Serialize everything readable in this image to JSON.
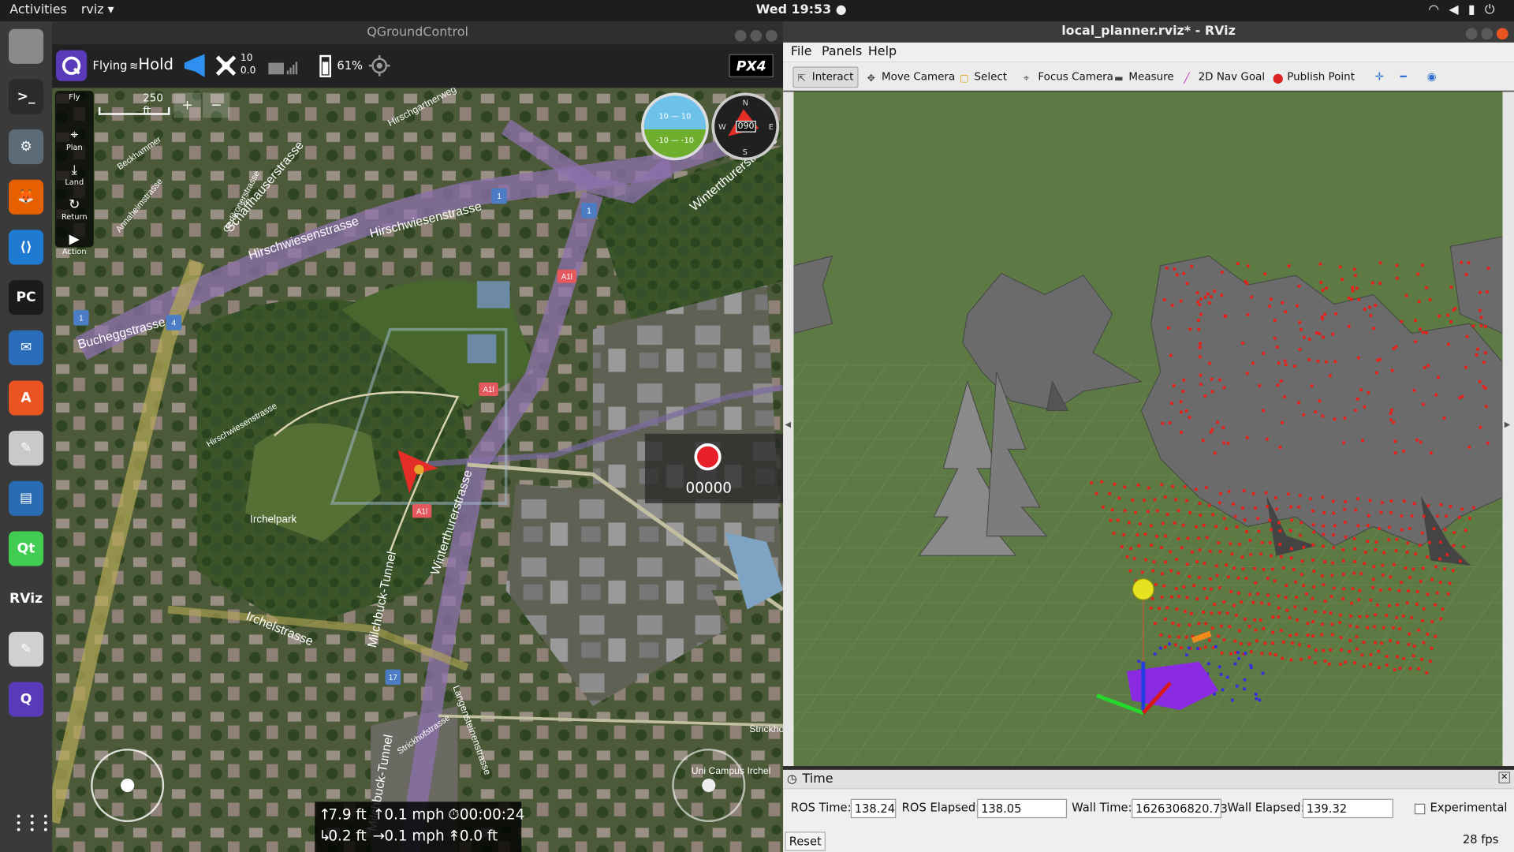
{
  "topbar": {
    "activities": "Activities",
    "app_name": "rviz ▾",
    "clock": "Wed 19:53 ●",
    "tray_icons": [
      "wifi-icon",
      "volume-icon",
      "battery-icon",
      "power-icon"
    ]
  },
  "dock": {
    "apps": [
      {
        "name": "files",
        "label": "",
        "color": "#8a8a8a"
      },
      {
        "name": "terminal",
        "label": ">_",
        "color": "#2b2b2b"
      },
      {
        "name": "settings",
        "label": "⚙",
        "color": "#5c6b78"
      },
      {
        "name": "firefox",
        "label": "🦊",
        "color": "#e66000"
      },
      {
        "name": "vscode",
        "label": "⟨⟩",
        "color": "#1f7ad2"
      },
      {
        "name": "pycharm",
        "label": "PC",
        "color": "#1b1b1b"
      },
      {
        "name": "thunderbird",
        "label": "✉",
        "color": "#2a6ebb"
      },
      {
        "name": "software",
        "label": "A",
        "color": "#e95420"
      },
      {
        "name": "text-editor",
        "label": "✎",
        "color": "#c9c9c9"
      },
      {
        "name": "libreoffice-writer",
        "label": "▤",
        "color": "#2a6cb2"
      },
      {
        "name": "qt-creator",
        "label": "Qt",
        "color": "#41cd52"
      },
      {
        "name": "rviz",
        "label": "RViz",
        "color": "#3a3a3a"
      },
      {
        "name": "gedit",
        "label": "✎",
        "color": "#d0d0d0"
      },
      {
        "name": "qgroundcontrol",
        "label": "Q",
        "color": "#5a3ab8"
      }
    ]
  },
  "qgc": {
    "window_title": "QGroundControl",
    "flight_mode_state": "Flying",
    "flight_mode": "Hold",
    "gps_count": "10",
    "gps_hdop": "0.0",
    "battery": "61%",
    "brand": "PX4",
    "scale_label": "250 ft",
    "left_tools": [
      {
        "label": "Fly",
        "icon": "plane-icon"
      },
      {
        "label": "Plan",
        "icon": "waypoint-icon"
      },
      {
        "label": "Land",
        "icon": "land-icon"
      },
      {
        "label": "Return",
        "icon": "return-icon"
      },
      {
        "label": "Action",
        "icon": "play-icon"
      }
    ],
    "attitude": {
      "pitch_up": "10 — 10",
      "pitch_down": "-10 — -10"
    },
    "compass": {
      "heading": "090",
      "n": "N",
      "s": "S",
      "e": "E",
      "w": "W"
    },
    "record_counter": "00000",
    "map_labels": [
      "Hirschwiesenstrasse",
      "Hirschwiesenstrasse",
      "Schaffhauserstrasse",
      "Bucheggstrasse",
      "Irchelpark",
      "Irchelstrasse",
      "Milchbuck-Tunnel",
      "Winterthurerstrasse",
      "Hirschgartnerweg",
      "Langensteinenstrasse",
      "Strickhofstrasse",
      "Oerlikonerstrasse",
      "Beckhammer",
      "Annaheimstrasse",
      "Uni Campus Irchel",
      "Strickho",
      "Milchbuck-Tunnel",
      "Winterthurerstrasse",
      "Hirschwiesenstrasse"
    ],
    "route_badges": [
      "1",
      "1",
      "1",
      "4",
      "A1l",
      "A1l",
      "A1l",
      "17"
    ],
    "telemetry": {
      "alt": "7.9 ft",
      "vspeed": "0.1 mph",
      "time": "00:00:24",
      "dist": "0.2 ft",
      "hspeed": "0.1 mph",
      "dist_home": "0.0 ft"
    }
  },
  "rviz": {
    "window_title": "local_planner.rviz* - RViz",
    "menu": [
      "File",
      "Panels",
      "Help"
    ],
    "tools": [
      {
        "label": "Interact",
        "icon": "cursor-icon",
        "active": true
      },
      {
        "label": "Move Camera",
        "icon": "move-icon",
        "active": false
      },
      {
        "label": "Select",
        "icon": "select-icon",
        "active": false
      },
      {
        "label": "Focus Camera",
        "icon": "focus-icon",
        "active": false
      },
      {
        "label": "Measure",
        "icon": "ruler-icon",
        "active": false
      },
      {
        "label": "2D Nav Goal",
        "icon": "nav-goal-icon",
        "active": false
      },
      {
        "label": "Publish Point",
        "icon": "pin-icon",
        "active": false
      }
    ],
    "time_panel": {
      "title": "Time",
      "ros_time_label": "ROS Time:",
      "ros_time": "138.24",
      "ros_elapsed_label": "ROS Elapsed:",
      "ros_elapsed": "138.05",
      "wall_time_label": "Wall Time:",
      "wall_time": "1626306820.73",
      "wall_elapsed_label": "Wall Elapsed:",
      "wall_elapsed": "139.32",
      "experimental_label": "Experimental",
      "reset_label": "Reset",
      "fps": "28 fps"
    }
  },
  "colors": {
    "accent": "#e95420",
    "map_bg": "#3f5030",
    "ground": "#5d7a45",
    "points": "#e8201a",
    "purple": "#8a2be2"
  }
}
